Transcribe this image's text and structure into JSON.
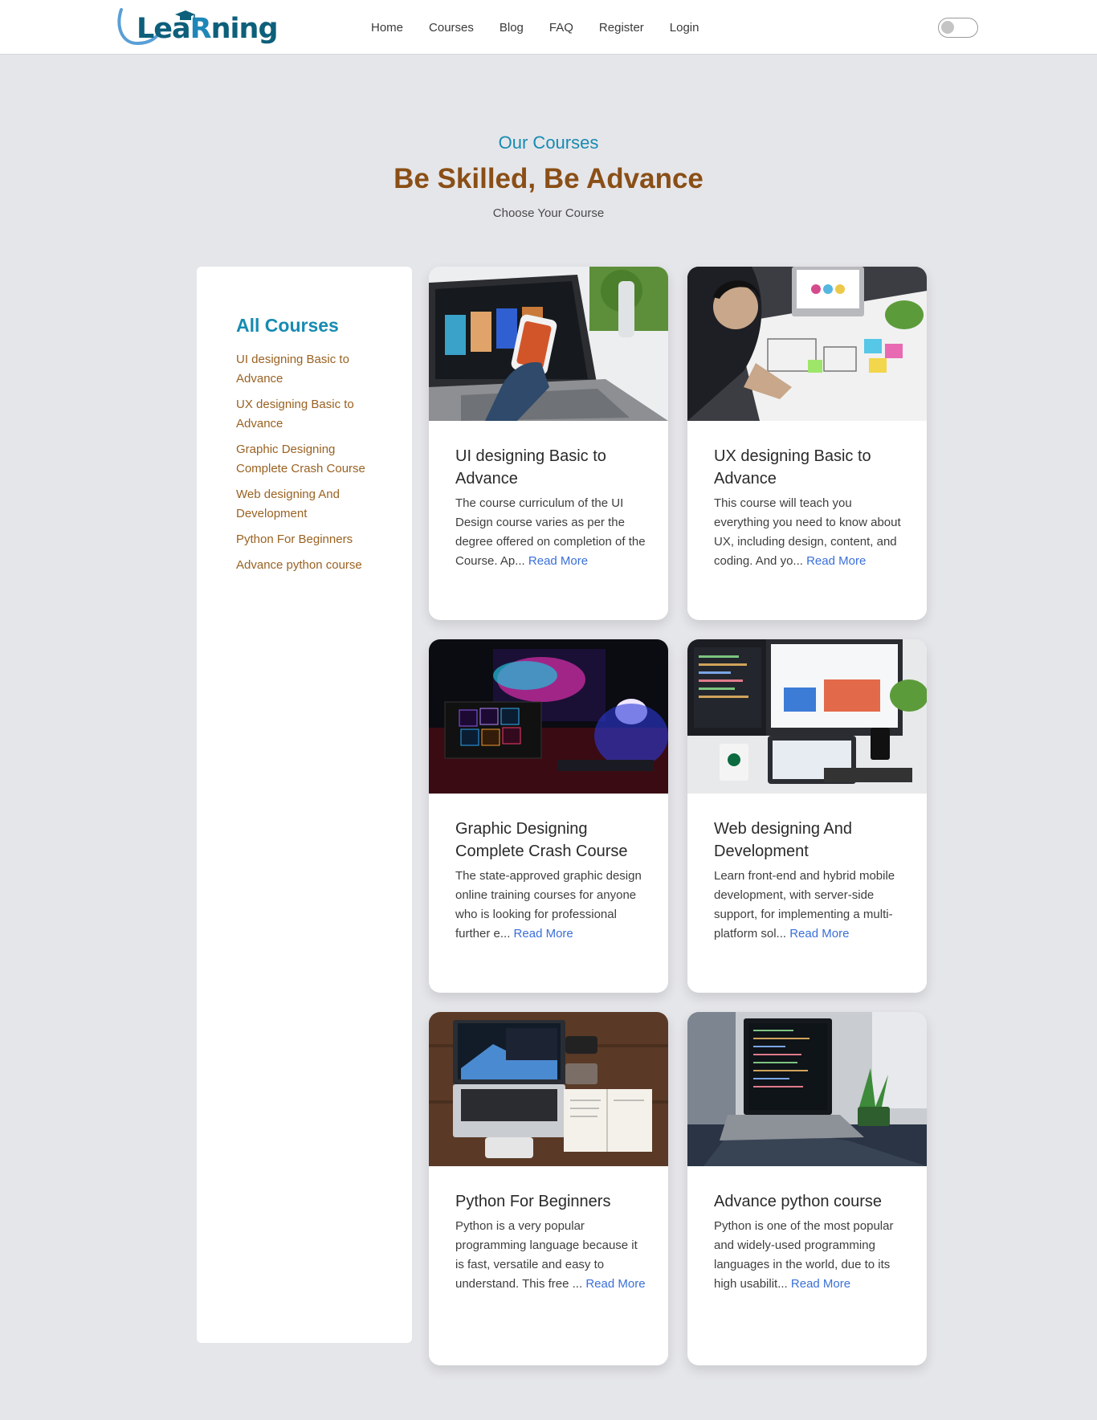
{
  "header": {
    "logo_text_a": "Lea",
    "logo_text_b": "R",
    "logo_text_c": "ning",
    "nav": [
      "Home",
      "Courses",
      "Blog",
      "FAQ",
      "Register",
      "Login"
    ]
  },
  "section": {
    "eyebrow": "Our Courses",
    "title": "Be Skilled, Be Advance",
    "subtitle": "Choose Your Course"
  },
  "sidebar": {
    "title": "All Courses",
    "items": [
      "UI designing Basic to Advance",
      "UX designing Basic to Advance",
      "Graphic Designing Complete Crash Course",
      "Web designing And Development",
      "Python For Beginners",
      "Advance python course"
    ]
  },
  "courses": [
    {
      "title": "UI designing Basic to Advance",
      "desc": "The course curriculum of the UI Design course varies as per the degree offered on completion of the Course. Ap...",
      "read_more": "Read More",
      "image": "laptop-phone-ui-photo"
    },
    {
      "title": "UX designing Basic to Advance",
      "desc": "This course will teach you everything you need to know about UX, including design, content, and coding. And yo...",
      "read_more": "Read More",
      "image": "ux-wireframe-desk-photo"
    },
    {
      "title": "Graphic Designing Complete Crash Course",
      "desc": "The state-approved graphic design online training courses for anyone who is looking for professional further e...",
      "read_more": "Read More",
      "image": "adobe-apps-monitor-photo"
    },
    {
      "title": "Web designing And Development",
      "desc": "Learn front-end and hybrid mobile development, with server-side support, for implementing a multi-platform sol...",
      "read_more": "Read More",
      "image": "web-dev-workstation-photo"
    },
    {
      "title": "Python For Beginners",
      "desc": "Python is a very popular programming language because it is fast, versatile and easy to understand. This free ...",
      "read_more": "Read More",
      "image": "laptop-notebook-desk-photo"
    },
    {
      "title": "Advance python course",
      "desc": "Python is one of the most popular and widely-used programming languages in the world, due to its high usabilit...",
      "read_more": "Read More",
      "image": "laptop-code-table-photo"
    }
  ],
  "colors": {
    "accent_blue": "#178bb2",
    "brown_heading": "#8a4f16",
    "sidebar_link": "#9a6222",
    "read_more": "#3a6fd8",
    "page_bg": "#e5e6ea"
  }
}
